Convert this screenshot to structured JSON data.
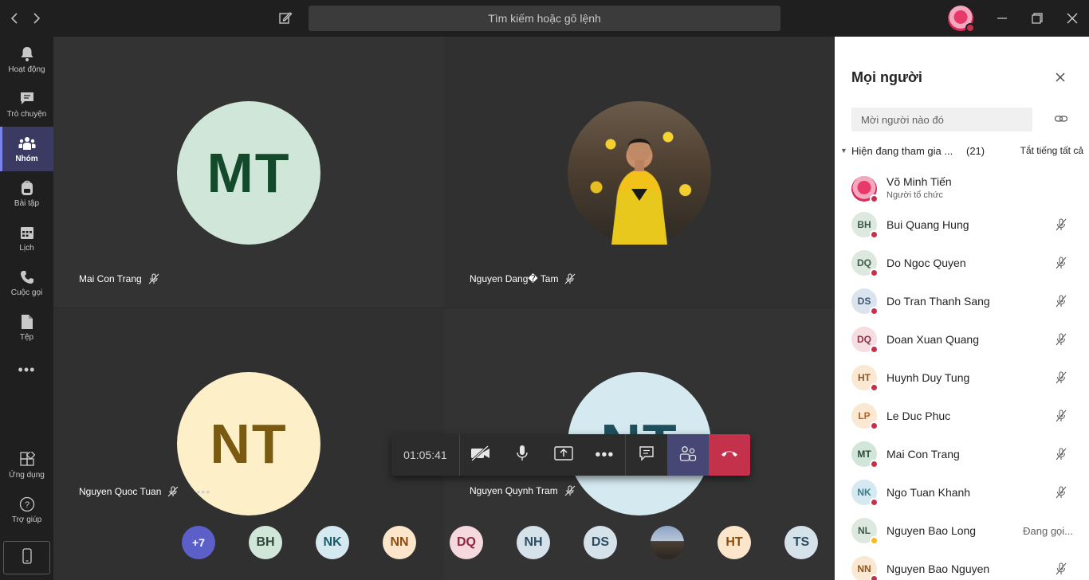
{
  "titlebar": {
    "search_placeholder": "Tìm kiếm hoặc gõ lệnh",
    "back_icon": "chevron-left-icon",
    "forward_icon": "chevron-right-icon",
    "compose_icon": "compose-icon"
  },
  "rail": {
    "items": [
      {
        "label": "Hoạt động",
        "icon": "bell-icon"
      },
      {
        "label": "Trò chuyện",
        "icon": "chat-icon"
      },
      {
        "label": "Nhóm",
        "icon": "teams-icon",
        "active": true
      },
      {
        "label": "Bài tập",
        "icon": "backpack-icon"
      },
      {
        "label": "Lịch",
        "icon": "calendar-icon"
      },
      {
        "label": "Cuộc gọi",
        "icon": "phone-icon"
      },
      {
        "label": "Tệp",
        "icon": "file-icon"
      }
    ],
    "more": "•••",
    "apps_label": "Ứng dụng",
    "help_label": "Trợ giúp"
  },
  "stage": {
    "tiles": [
      {
        "initials": "MT",
        "name": "Mai Con Trang"
      },
      {
        "initials": "",
        "name": "Nguyen Dang� Tam"
      },
      {
        "initials": "NT",
        "name": "Nguyen Quoc Tuan"
      },
      {
        "initials": "NT",
        "name": "Nguyen Quynh Tram"
      }
    ],
    "tile_more": "•••",
    "controls": {
      "timer": "01:05:41",
      "more": "•••"
    },
    "strip": [
      "+7",
      "BH",
      "NK",
      "NN",
      "DQ",
      "NH",
      "DS",
      "",
      "HT",
      "TS"
    ]
  },
  "panel": {
    "title": "Mọi người",
    "invite_placeholder": "Mời người nào đó",
    "section_title": "Hiện đang tham gia ...",
    "section_count": "(21)",
    "mute_all": "Tắt tiếng tất cả",
    "people": [
      {
        "initials": "",
        "name": "Võ Minh Tiến",
        "sub": "Người tổ chức"
      },
      {
        "initials": "BH",
        "name": "Bui Quang Hung"
      },
      {
        "initials": "DQ",
        "name": "Do Ngoc Quyen"
      },
      {
        "initials": "DS",
        "name": "Do Tran Thanh Sang"
      },
      {
        "initials": "DQ",
        "name": "Doan Xuan Quang"
      },
      {
        "initials": "HT",
        "name": "Huynh Duy Tung"
      },
      {
        "initials": "LP",
        "name": "Le Duc Phuc"
      },
      {
        "initials": "MT",
        "name": "Mai Con Trang"
      },
      {
        "initials": "NK",
        "name": "Ngo Tuan Khanh"
      },
      {
        "initials": "NL",
        "name": "Nguyen Bao Long",
        "status": "Đang gọi..."
      },
      {
        "initials": "NN",
        "name": "Nguyen Bao Nguyen"
      }
    ]
  },
  "colors": {
    "accent": "#464775",
    "hangup": "#c4314b",
    "presence_busy": "#c4314b"
  }
}
